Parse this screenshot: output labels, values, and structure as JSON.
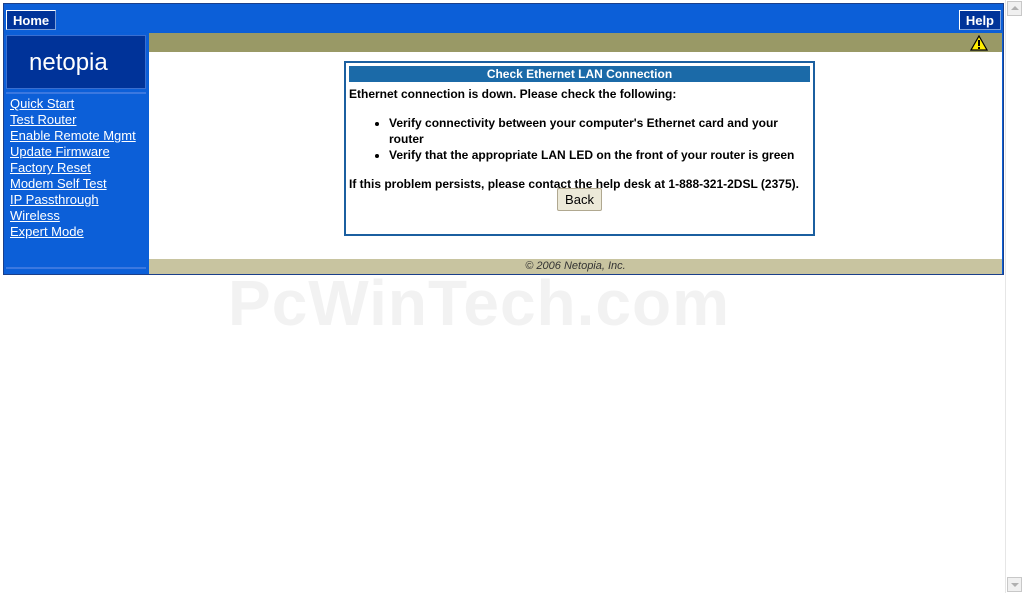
{
  "topbar": {
    "home_label": "Home",
    "help_label": "Help"
  },
  "sidebar": {
    "logo_text": "netopia",
    "items": [
      {
        "label": "Quick Start"
      },
      {
        "label": "Test Router"
      },
      {
        "label": "Enable Remote Mgmt"
      },
      {
        "label": "Update Firmware"
      },
      {
        "label": "Factory Reset"
      },
      {
        "label": "Modem Self Test"
      },
      {
        "label": "IP Passthrough"
      },
      {
        "label": "Wireless"
      },
      {
        "label": "Expert Mode"
      }
    ]
  },
  "dialog": {
    "title": "Check Ethernet LAN Connection",
    "intro": "Ethernet connection is down. Please check the following:",
    "checks": [
      "Verify connectivity between your computer's Ethernet card and your router",
      "Verify that the appropriate LAN LED on the front of your router is green"
    ],
    "persist_text": "If this problem persists, please contact the help desk at 1-888-321-2DSL (2375).",
    "back_label": "Back"
  },
  "footer": {
    "copyright": "© 2006 Netopia, Inc."
  },
  "watermark": "PcWinTech.com",
  "icons": {
    "warning": "warning-icon",
    "logo_mark": "netopia-o-icon"
  },
  "colors": {
    "brand_blue": "#0c5fd8",
    "dark_blue": "#003399",
    "olive": "#999966",
    "dialog_title": "#1b6aa8"
  }
}
